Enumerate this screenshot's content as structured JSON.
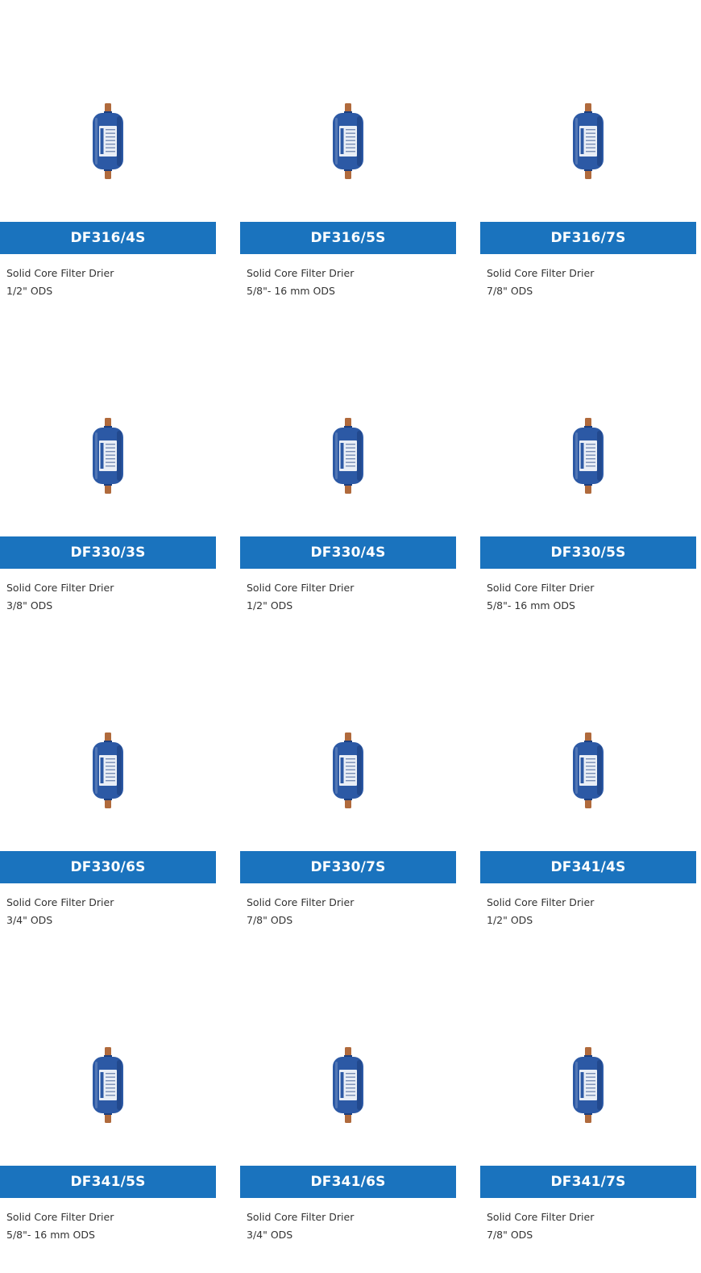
{
  "theme": {
    "accent": "#1a73be",
    "text": "#333333",
    "drier_body": "#2c59a5",
    "drier_shadow": "#1d3f7f",
    "copper": "#b06a3c",
    "label_bg": "#e9eef6"
  },
  "products": [
    {
      "code": "DF316/4S",
      "name": "Solid Core Filter Drier",
      "size": "1/2\" ODS",
      "image_icon": "filter-drier-icon"
    },
    {
      "code": "DF316/5S",
      "name": "Solid Core Filter Drier",
      "size": "5/8\"- 16 mm ODS",
      "image_icon": "filter-drier-icon"
    },
    {
      "code": "DF316/7S",
      "name": "Solid Core Filter Drier",
      "size": "7/8\" ODS",
      "image_icon": "filter-drier-icon"
    },
    {
      "code": "DF330/3S",
      "name": "Solid Core Filter Drier",
      "size": "3/8\" ODS",
      "image_icon": "filter-drier-icon"
    },
    {
      "code": "DF330/4S",
      "name": "Solid Core Filter Drier",
      "size": "1/2\" ODS",
      "image_icon": "filter-drier-icon"
    },
    {
      "code": "DF330/5S",
      "name": "Solid Core Filter Drier",
      "size": "5/8\"- 16 mm ODS",
      "image_icon": "filter-drier-icon"
    },
    {
      "code": "DF330/6S",
      "name": "Solid Core Filter Drier",
      "size": "3/4\" ODS",
      "image_icon": "filter-drier-icon"
    },
    {
      "code": "DF330/7S",
      "name": "Solid Core Filter Drier",
      "size": "7/8\" ODS",
      "image_icon": "filter-drier-icon"
    },
    {
      "code": "DF341/4S",
      "name": "Solid Core Filter Drier",
      "size": "1/2\" ODS",
      "image_icon": "filter-drier-icon"
    },
    {
      "code": "DF341/5S",
      "name": "Solid Core Filter Drier",
      "size": "5/8\"- 16 mm ODS",
      "image_icon": "filter-drier-icon"
    },
    {
      "code": "DF341/6S",
      "name": "Solid Core Filter Drier",
      "size": "3/4\" ODS",
      "image_icon": "filter-drier-icon"
    },
    {
      "code": "DF341/7S",
      "name": "Solid Core Filter Drier",
      "size": "7/8\" ODS",
      "image_icon": "filter-drier-icon"
    }
  ]
}
